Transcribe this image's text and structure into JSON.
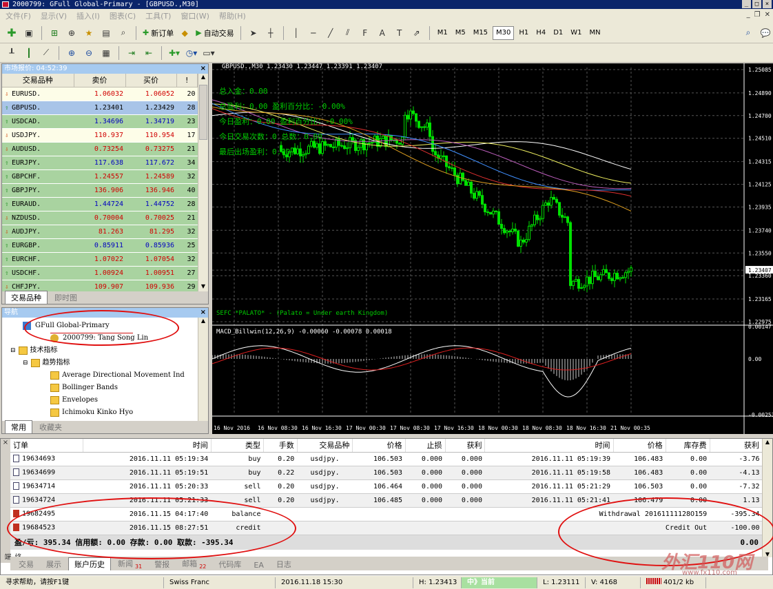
{
  "window": {
    "title": "2000799: GFull Global-Primary - [GBPUSD.,M30]"
  },
  "menu": [
    "文件(F)",
    "显示(V)",
    "插入(I)",
    "图表(C)",
    "工具(T)",
    "窗口(W)",
    "帮助(H)"
  ],
  "toolbar": {
    "new_order": "新订单",
    "auto_trade": "自动交易",
    "timeframes": [
      "M1",
      "M5",
      "M15",
      "M30",
      "H1",
      "H4",
      "D1",
      "W1",
      "MN"
    ],
    "active_tf": "M30"
  },
  "market_watch": {
    "title": "市场报价: 04:52:39",
    "headers": [
      "交易品种",
      "卖价",
      "买价",
      "!"
    ],
    "rows": [
      {
        "dir": "down",
        "sym": "EURUSD.",
        "bid": "1.06032",
        "ask": "1.06052",
        "spread": "20",
        "bg": "#fdfde8",
        "color": "#d00000"
      },
      {
        "dir": "up",
        "sym": "GBPUSD.",
        "bid": "1.23401",
        "ask": "1.23429",
        "spread": "28",
        "bg": "#a8c4e8",
        "color": "#000000"
      },
      {
        "dir": "up",
        "sym": "USDCAD.",
        "bid": "1.34696",
        "ask": "1.34719",
        "spread": "23",
        "bg": "#a9d3a0",
        "color": "#0000c0"
      },
      {
        "dir": "down",
        "sym": "USDJPY.",
        "bid": "110.937",
        "ask": "110.954",
        "spread": "17",
        "bg": "#fdfde8",
        "color": "#d00000"
      },
      {
        "dir": "down",
        "sym": "AUDUSD.",
        "bid": "0.73254",
        "ask": "0.73275",
        "spread": "21",
        "bg": "#a9d3a0",
        "color": "#d00000"
      },
      {
        "dir": "up",
        "sym": "EURJPY.",
        "bid": "117.638",
        "ask": "117.672",
        "spread": "34",
        "bg": "#a9d3a0",
        "color": "#0000c0"
      },
      {
        "dir": "up",
        "sym": "GBPCHF.",
        "bid": "1.24557",
        "ask": "1.24589",
        "spread": "32",
        "bg": "#a9d3a0",
        "color": "#d00000"
      },
      {
        "dir": "up",
        "sym": "GBPJPY.",
        "bid": "136.906",
        "ask": "136.946",
        "spread": "40",
        "bg": "#a9d3a0",
        "color": "#d00000"
      },
      {
        "dir": "up",
        "sym": "EURAUD.",
        "bid": "1.44724",
        "ask": "1.44752",
        "spread": "28",
        "bg": "#a9d3a0",
        "color": "#0000c0"
      },
      {
        "dir": "down",
        "sym": "NZDUSD.",
        "bid": "0.70004",
        "ask": "0.70025",
        "spread": "21",
        "bg": "#a9d3a0",
        "color": "#d00000"
      },
      {
        "dir": "down",
        "sym": "AUDJPY.",
        "bid": "81.263",
        "ask": "81.295",
        "spread": "32",
        "bg": "#a9d3a0",
        "color": "#d00000"
      },
      {
        "dir": "up",
        "sym": "EURGBP.",
        "bid": "0.85911",
        "ask": "0.85936",
        "spread": "25",
        "bg": "#a9d3a0",
        "color": "#0000c0"
      },
      {
        "dir": "up",
        "sym": "EURCHF.",
        "bid": "1.07022",
        "ask": "1.07054",
        "spread": "32",
        "bg": "#a9d3a0",
        "color": "#d00000"
      },
      {
        "dir": "up",
        "sym": "USDCHF.",
        "bid": "1.00924",
        "ask": "1.00951",
        "spread": "27",
        "bg": "#a9d3a0",
        "color": "#d00000"
      },
      {
        "dir": "down",
        "sym": "CHFJPY.",
        "bid": "109.907",
        "ask": "109.936",
        "spread": "29",
        "bg": "#a9d3a0",
        "color": "#d00000"
      }
    ],
    "tabs": [
      "交易品种",
      "即时图"
    ]
  },
  "navigator": {
    "title": "导航",
    "items": [
      "GFull Global-Primary",
      "2000799: Tang Song Lin",
      "技术指标",
      "趋势指标",
      "Average Directional Movement Ind",
      "Bollinger Bands",
      "Envelopes",
      "Ichimoku Kinko Hyo"
    ],
    "tabs": [
      "常用",
      "收藏夹"
    ]
  },
  "chart": {
    "header": "GBPUSD.,M30  1.23430 1.23447 1.23391 1.23407",
    "info_lines": [
      "总入金：0.00",
      "总盈利：0.00  盈利百分比：-0.00%",
      "今日盈利：0.00  盈利百分比：-0.00%",
      "今日交易次数：0  总数：0.00",
      "最后出场盈利：0.00"
    ],
    "ea_label": "SEFC *PALATO* - (Palato = Under earth Kingdom)",
    "price_axis": [
      "1.25085",
      "1.24890",
      "1.24700",
      "1.24510",
      "1.24315",
      "1.24125",
      "1.23935",
      "1.23740",
      "1.23550",
      "1.23407",
      "1.23360",
      "1.23165",
      "1.22975"
    ],
    "time_axis": [
      "16 Nov 2016",
      "16 Nov 08:30",
      "16 Nov 16:30",
      "17 Nov 00:30",
      "17 Nov 08:30",
      "17 Nov 16:30",
      "18 Nov 00:30",
      "18 Nov 08:30",
      "18 Nov 16:30",
      "21 Nov 00:35"
    ],
    "macd_label": "MACD_Billwin(12,26,9) -0.00060 -0.00078 0.00018",
    "macd_axis": [
      "0.00147",
      "0.00",
      "-0.00253"
    ],
    "up_color": "#00e000",
    "ma_colors": [
      "#ffffff",
      "#f0f060",
      "#c060c0",
      "#4090ff",
      "#e03030",
      "#e0a020"
    ]
  },
  "terminal": {
    "headers": [
      "订单",
      "时间",
      "类型",
      "手数",
      "交易品种",
      "价格",
      "止损",
      "获利",
      "时间",
      "价格",
      "库存费",
      "获利"
    ],
    "rows": [
      [
        "19634693",
        "2016.11.11 05:19:34",
        "buy",
        "0.20",
        "usdjpy.",
        "106.503",
        "0.000",
        "0.000",
        "2016.11.11 05:19:39",
        "106.483",
        "0.00",
        "-3.76"
      ],
      [
        "19634699",
        "2016.11.11 05:19:51",
        "buy",
        "0.22",
        "usdjpy.",
        "106.503",
        "0.000",
        "0.000",
        "2016.11.11 05:19:58",
        "106.483",
        "0.00",
        "-4.13"
      ],
      [
        "19634714",
        "2016.11.11 05:20:33",
        "sell",
        "0.20",
        "usdjpy.",
        "106.464",
        "0.000",
        "0.000",
        "2016.11.11 05:21:29",
        "106.503",
        "0.00",
        "-7.32"
      ],
      [
        "19634724",
        "2016.11.11 05:21:33",
        "sell",
        "0.20",
        "usdjpy.",
        "106.485",
        "0.000",
        "0.000",
        "2016.11.11 05:21:41",
        "106.479",
        "0.00",
        "1.13"
      ]
    ],
    "balance_rows": [
      {
        "order": "19682495",
        "time": "2016.11.15 04:17:40",
        "type": "balance",
        "comment": "Withdrawal 20161111128O159",
        "profit": "-395.34"
      },
      {
        "order": "19684523",
        "time": "2016.11.15 08:27:51",
        "type": "credit",
        "comment": "Credit Out",
        "profit": "-100.00"
      }
    ],
    "summary": "盈/亏: 395.34  信用额: 0.00  存款: 0.00  取款: -395.34",
    "summary_total": "0.00",
    "side_label": "终端",
    "tabs": [
      "交易",
      "展示",
      "账户历史",
      "新闻",
      "警报",
      "邮箱",
      "代码库",
      "EA",
      "日志"
    ],
    "badges": {
      "新闻": "31",
      "邮箱": "22"
    },
    "active_tab": "账户历史"
  },
  "status": {
    "help": "寻求帮助，请按F1键",
    "profile": "Swiss Franc",
    "datetime": "2016.11.18 15:30",
    "high": "H: 1.23413",
    "low": "L: 1.23111",
    "volume": "V: 4168",
    "traffic": "401/2 kb"
  },
  "watermark": {
    "text": "外汇110网",
    "url": "www.fx110.com",
    "toast": "中》当前"
  }
}
